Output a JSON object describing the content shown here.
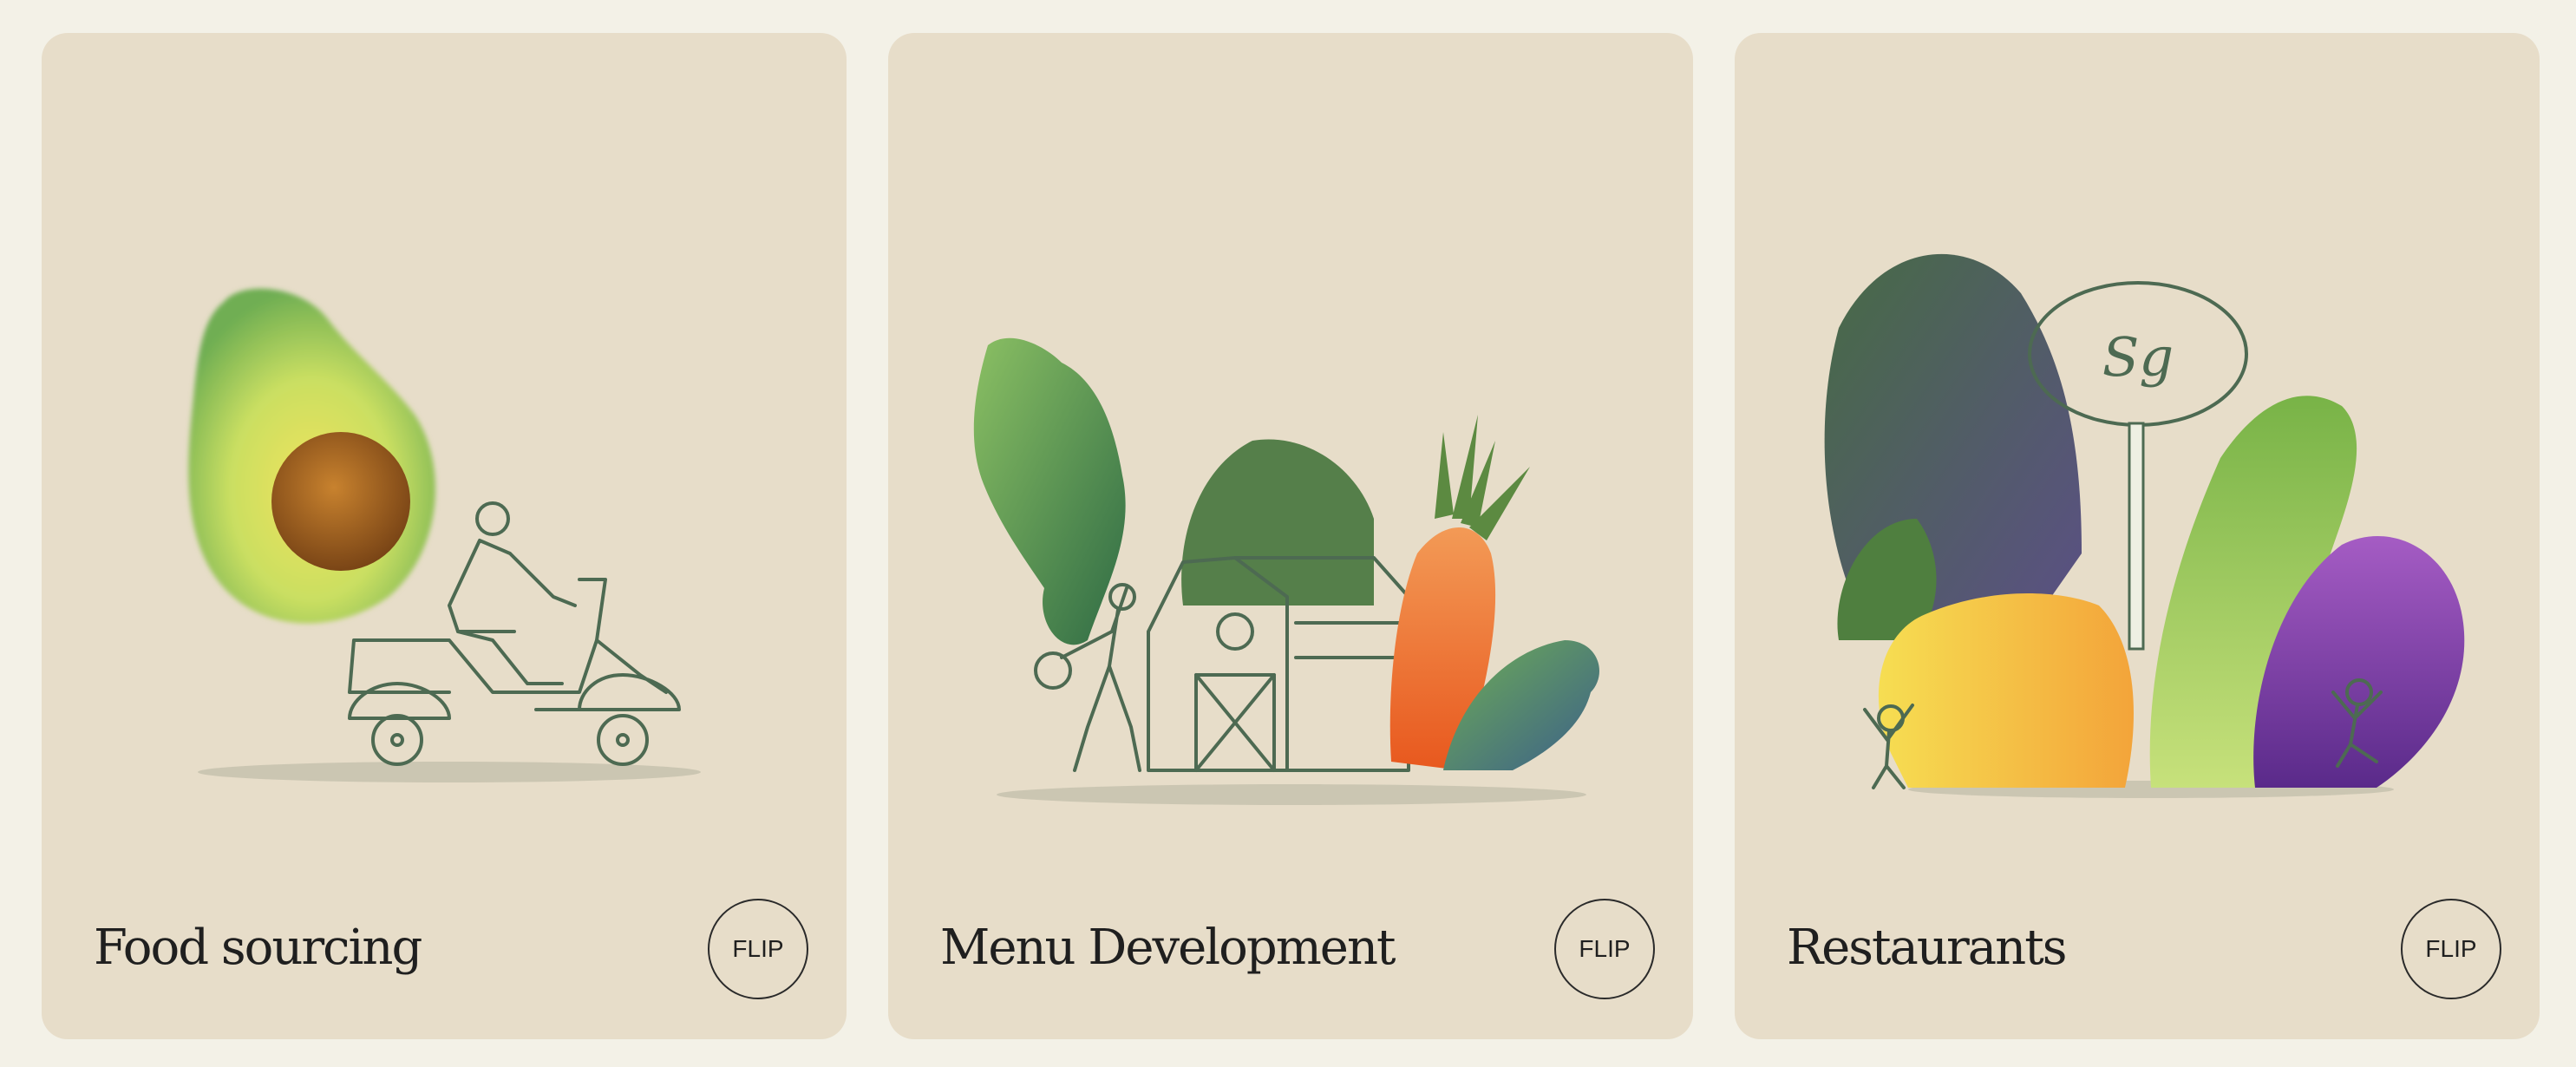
{
  "cards": [
    {
      "title": "Food sourcing",
      "button_label": "FLIP"
    },
    {
      "title": "Menu Development",
      "button_label": "FLIP"
    },
    {
      "title": "Restaurants",
      "button_label": "FLIP"
    }
  ],
  "sign_text": "Sg"
}
